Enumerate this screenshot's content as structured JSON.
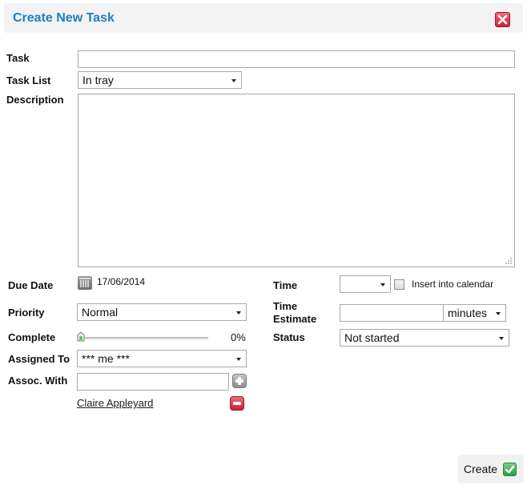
{
  "dialog": {
    "title": "Create New Task"
  },
  "form": {
    "task_label": "Task",
    "task_value": "",
    "task_list_label": "Task List",
    "task_list_value": "In tray",
    "description_label": "Description",
    "due_date_label": "Due Date",
    "due_date_value": "17/06/2014",
    "time_label": "Time",
    "time_value": "",
    "insert_calendar_label": "Insert into calendar",
    "priority_label": "Priority",
    "priority_value": "Normal",
    "time_estimate_label_1": "Time",
    "time_estimate_label_2": "Estimate",
    "time_estimate_value": "",
    "time_unit_value": "minutes",
    "complete_label": "Complete",
    "complete_percent": 0,
    "complete_text": "0%",
    "status_label": "Status",
    "status_value": "Not started",
    "assigned_label": "Assigned To",
    "assigned_value": "*** me ***",
    "assoc_label": "Assoc. With",
    "assoc_value": "",
    "assoc_contact": "Claire Appleyard"
  },
  "footer": {
    "create_label": "Create"
  },
  "colors": {
    "title": "#1a7fc1",
    "close": "#d6334a",
    "ok": "#2d9b46"
  }
}
